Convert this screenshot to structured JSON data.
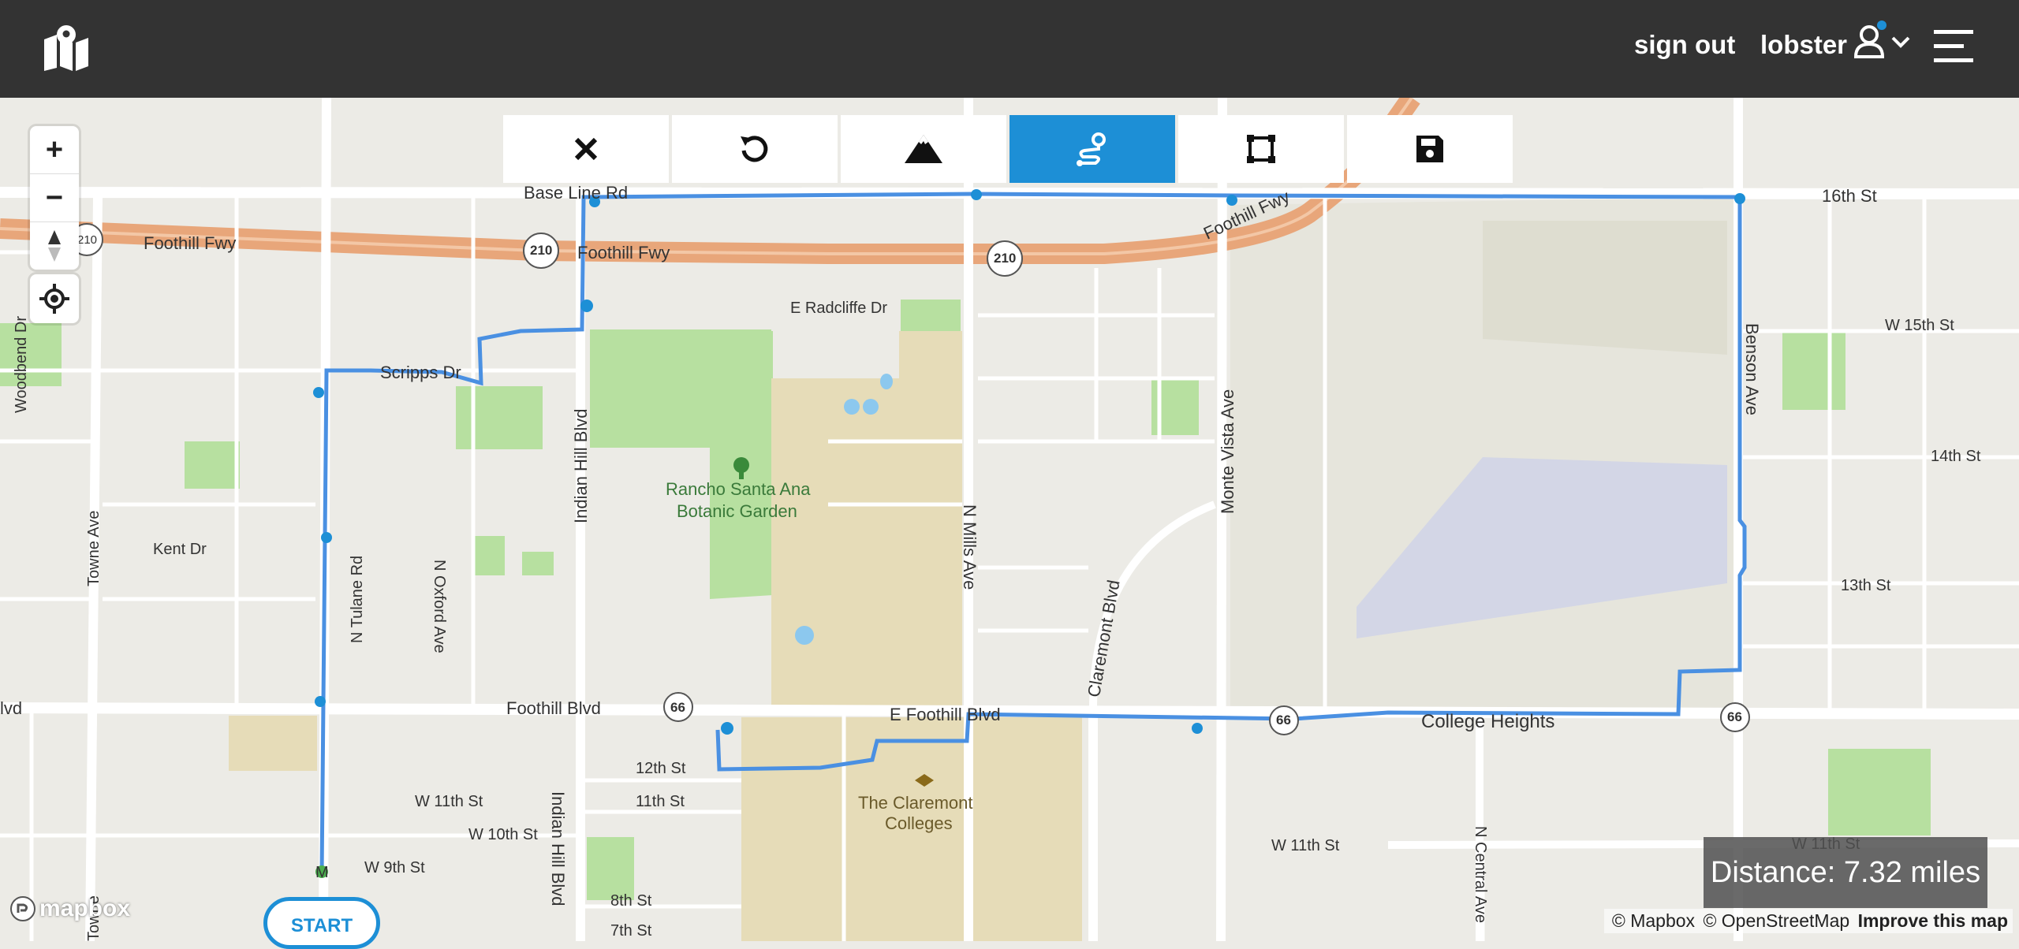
{
  "header": {
    "signout_label": "sign out",
    "username": "lobster",
    "logo_icon": "map-pin-logo-icon",
    "user_icon": "user-icon",
    "menu_icon": "hamburger-menu-icon"
  },
  "toolbar": {
    "tools": [
      {
        "name": "close",
        "icon": "close-icon",
        "active": false
      },
      {
        "name": "undo",
        "icon": "undo-icon",
        "active": false
      },
      {
        "name": "elevation",
        "icon": "mountain-icon",
        "active": false
      },
      {
        "name": "route",
        "icon": "route-icon",
        "active": true
      },
      {
        "name": "shape",
        "icon": "polygon-icon",
        "active": false
      },
      {
        "name": "save",
        "icon": "save-icon",
        "active": false
      }
    ],
    "active_color": "#1d8fd6"
  },
  "map_controls": {
    "zoom_in": "+",
    "zoom_out": "−"
  },
  "distance": {
    "label": "Distance:",
    "value": "7.32 miles",
    "text": "Distance: 7.32 miles"
  },
  "start_button": {
    "label": "START"
  },
  "attribution": {
    "mapbox": "© Mapbox",
    "osm": "© OpenStreetMap",
    "improve": "Improve this map",
    "logo": "mapbox"
  },
  "map_labels": {
    "base_line_rd": "Base Line Rd",
    "foothill_fwy_left": "Foothill Fwy",
    "foothill_fwy_mid": "Foothill Fwy",
    "foothill_fwy_right": "Foothill Fwy",
    "sixteenth_st": "16th St",
    "e_radcliffe": "E Radcliffe Dr",
    "scripps": "Scripps Dr",
    "w_15th": "W 15th St",
    "fourteenth": "14th St",
    "thirteenth": "13th St",
    "woodbend": "Woodbend Dr",
    "towne": "Towne Ave",
    "towne_bottom": "Towne",
    "kent": "Kent Dr",
    "tulane": "N Tulane Rd",
    "oxford": "N Oxford Ave",
    "indian_hill": "Indian Hill Blvd",
    "indian_hill_bottom": "Indian Hill Blvd",
    "mills": "N Mills Ave",
    "claremont": "Claremont Blvd",
    "monte_vista": "Monte Vista Ave",
    "benson": "Benson Ave",
    "foothill_blvd_left": "Foothill Blvd",
    "foothill_blvd_edge": "lvd",
    "e_foothill": "E Foothill Blvd",
    "college_heights": "College Heights",
    "twelfth": "12th St",
    "eleventh": "11th St",
    "w_11th_left": "W 11th St",
    "w_10th": "W 10th St",
    "w_9th": "W 9th St",
    "eighth": "8th St",
    "seventh": "7th St",
    "w_11th_mid": "W 11th St",
    "w_11th_right": "W 11th St",
    "central": "N Central Ave",
    "botanic_1": "Rancho Santa Ana",
    "botanic_2": "Botanic Garden",
    "colleges_1": "The Claremont",
    "colleges_2": "Colleges",
    "hwy_210_a": "210",
    "hwy_210_b": "210",
    "hwy_210_c": "210",
    "hwy_66_a": "66",
    "hwy_66_b": "66",
    "hwy_66_c": "66",
    "tulane_bottom": "M"
  },
  "colors": {
    "route": "#4a90e2",
    "park": "#b7e0a0",
    "campus": "#e6dcb8",
    "freeway": "#e8a67a",
    "airport": "#d3d6e6"
  }
}
